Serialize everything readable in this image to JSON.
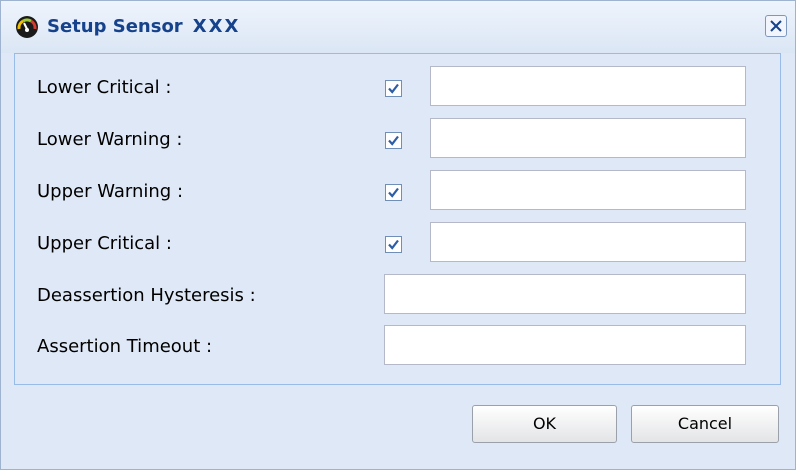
{
  "dialog": {
    "title": "Setup Sensor",
    "title_suffix": "XXX",
    "close_icon": "close-icon"
  },
  "fields": [
    {
      "label": "Lower Critical :",
      "checked": true,
      "value": ""
    },
    {
      "label": "Lower Warning :",
      "checked": true,
      "value": ""
    },
    {
      "label": "Upper Warning :",
      "checked": true,
      "value": ""
    },
    {
      "label": "Upper Critical :",
      "checked": true,
      "value": ""
    },
    {
      "label": "Deassertion Hysteresis :",
      "value": ""
    },
    {
      "label": "Assertion Timeout :",
      "value": ""
    }
  ],
  "buttons": {
    "ok": "OK",
    "cancel": "Cancel"
  },
  "colors": {
    "title_text": "#15428b",
    "panel_bg": "#dfe8f6",
    "panel_border": "#99bbe8"
  }
}
